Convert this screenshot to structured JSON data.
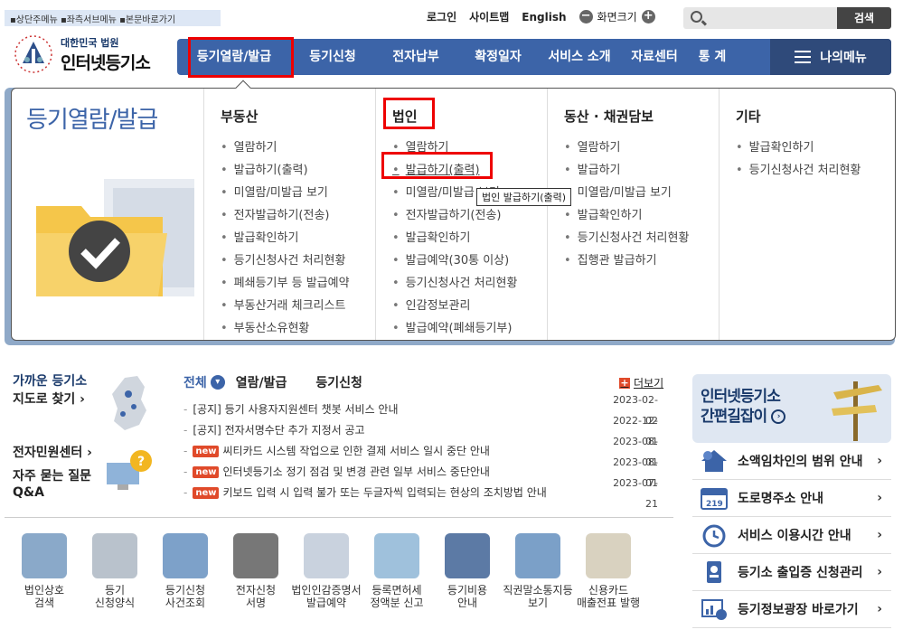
{
  "skip_links": "▪상단주메뉴 ▪좌측서브메뉴 ▪본문바로가기",
  "top": {
    "login": "로그인",
    "sitemap": "사이트맵",
    "english": "English",
    "zoom": "화면크기"
  },
  "search": {
    "button": "검색",
    "placeholder": ""
  },
  "logo": {
    "line1": "대한민국 법원",
    "line2": "인터넷등기소"
  },
  "gnb": {
    "items": [
      "등기열람/발급",
      "등기신청",
      "전자납부",
      "확정일자",
      "서비스 소개",
      "자료센터",
      "통 계"
    ],
    "mymenu": "나의메뉴"
  },
  "mega": {
    "title": "등기열람/발급",
    "columns": [
      {
        "heading": "부동산",
        "items": [
          "열람하기",
          "발급하기(출력)",
          "미열람/미발급 보기",
          "전자발급하기(전송)",
          "발급확인하기",
          "등기신청사건 처리현황",
          "폐쇄등기부 등 발급예약",
          "부동산거래 체크리스트",
          "부동산소유현황"
        ]
      },
      {
        "heading": "법인",
        "items": [
          "열람하기",
          "발급하기(출력)",
          "미열람/미발급 보기",
          "전자발급하기(전송)",
          "발급확인하기",
          "발급예약(30통 이상)",
          "등기신청사건 처리현황",
          "인감정보관리",
          "발급예약(폐쇄등기부)"
        ]
      },
      {
        "heading": "동산 · 채권담보",
        "items": [
          "열람하기",
          "발급하기",
          "미열람/미발급 보기",
          "발급확인하기",
          "등기신청사건 처리현황",
          "집행관 발급하기"
        ]
      },
      {
        "heading": "기타",
        "items": [
          "발급확인하기",
          "등기신청사건 처리현황"
        ]
      }
    ],
    "tooltip": "법인 발급하기(출력)"
  },
  "left": {
    "map_title1": "가까운 등기소",
    "map_title2": "지도로 찾기 ›",
    "center_title": "전자민원센터 ›",
    "faq1": "자주 묻는 질문",
    "faq2": "Q&A"
  },
  "news_tabs": {
    "all": "전체",
    "tab1": "열람/발급",
    "tab2": "등기신청",
    "more": "더보기"
  },
  "news": [
    {
      "tag": "",
      "title": "[공지] 등기 사용자지원센터 챗봇 서비스 안내",
      "date": "2023-02-02"
    },
    {
      "tag": "",
      "title": "[공지] 전자서명수단 추가 지정서 공고",
      "date": "2022-12-01"
    },
    {
      "tag": "new",
      "title": "씨티카드 시스템 작업으로 인한 결제 서비스 일시 중단 안내",
      "date": "2023-08-01"
    },
    {
      "tag": "new",
      "title": "인터넷등기소 정기 점검 및 변경 관련 일부 서비스 중단안내",
      "date": "2023-08-01"
    },
    {
      "tag": "new",
      "title": "키보드 입력 시 입력 불가 또는 두글자씩 입력되는 현상의 조치방법 안내",
      "date": "2023-07-21"
    }
  ],
  "quick": [
    {
      "l1": "법인상호",
      "l2": "검색",
      "icon": "magnifier-icon",
      "color": "#8aa9c9"
    },
    {
      "l1": "등기",
      "l2": "신청양식",
      "icon": "form-icon",
      "color": "#b9c2cc"
    },
    {
      "l1": "등기신청",
      "l2": "사건조회",
      "icon": "monitor-icon",
      "color": "#7da1c9"
    },
    {
      "l1": "전자신청",
      "l2": "서명",
      "icon": "pen-icon",
      "color": "#777777"
    },
    {
      "l1": "법인인감증명서",
      "l2": "발급예약",
      "icon": "calendar-icon",
      "color": "#c9d2de"
    },
    {
      "l1": "등록면허세",
      "l2": "정액분 신고",
      "icon": "document-icon",
      "color": "#9fc1dc"
    },
    {
      "l1": "등기비용",
      "l2": "안내",
      "icon": "question-icon",
      "color": "#5c7aa5"
    },
    {
      "l1": "직권말소통지등",
      "l2": "보기",
      "icon": "chat-icon",
      "color": "#7ba0c8"
    },
    {
      "l1": "신용카드",
      "l2": "매출전표 발행",
      "icon": "receipt-icon",
      "color": "#d9d2c0"
    }
  ],
  "right": {
    "banner1": "인터넷등기소",
    "banner2": "간편길잡이",
    "list": [
      {
        "label": "소액임차인의 범위 안내",
        "icon": "house-icon"
      },
      {
        "label": "도로명주소 안내",
        "icon": "address-sign-icon"
      },
      {
        "label": "서비스 이용시간 안내",
        "icon": "clock-icon"
      },
      {
        "label": "등기소 출입증 신청관리",
        "icon": "badge-icon"
      },
      {
        "label": "등기정보광장 바로가기",
        "icon": "chart-icon"
      }
    ]
  },
  "colors": {
    "primary": "#3c64a8",
    "highlight": "#e00000"
  }
}
